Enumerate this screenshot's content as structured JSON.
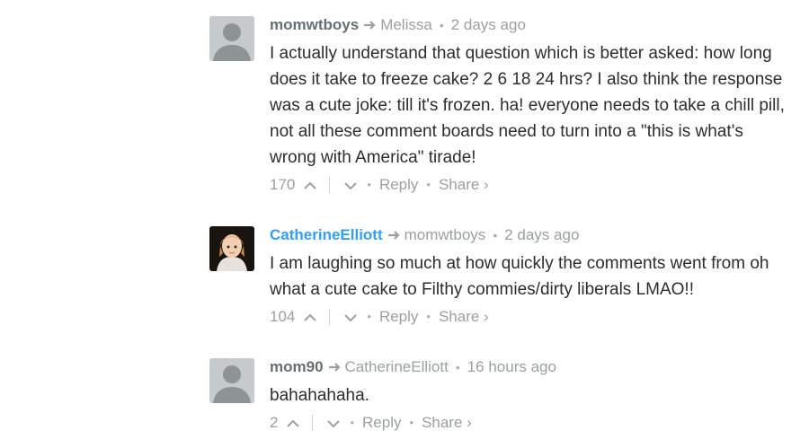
{
  "comments": [
    {
      "author": "momwtboys",
      "parent": "Melissa",
      "time": "2 days ago",
      "text": "I actually understand that question which is better asked: how long does it take to freeze cake? 2 6 18 24 hrs? I also think the response was a cute joke: till it's frozen. ha! everyone needs to take a chill pill, not all these comment boards need to turn into a \"this is what's wrong with America\" tirade!",
      "votes": "170",
      "reply": "Reply",
      "share": "Share ›",
      "dot": "•"
    },
    {
      "author": "CatherineElliott",
      "parent": "momwtboys",
      "time": "2 days ago",
      "text": "I am laughing so much at how quickly the comments went from oh what a cute cake to Filthy commies/dirty liberals LMAO!!",
      "votes": "104",
      "reply": "Reply",
      "share": "Share ›",
      "dot": "•"
    },
    {
      "author": "mom90",
      "parent": "CatherineElliott",
      "time": "16 hours ago",
      "text": "bahahahaha.",
      "votes": "2",
      "reply": "Reply",
      "share": "Share ›",
      "dot": "•"
    }
  ],
  "colors": {
    "accent_author": "#2e9fff",
    "meta": "#9aa0a3",
    "text": "#2a2e2e"
  }
}
